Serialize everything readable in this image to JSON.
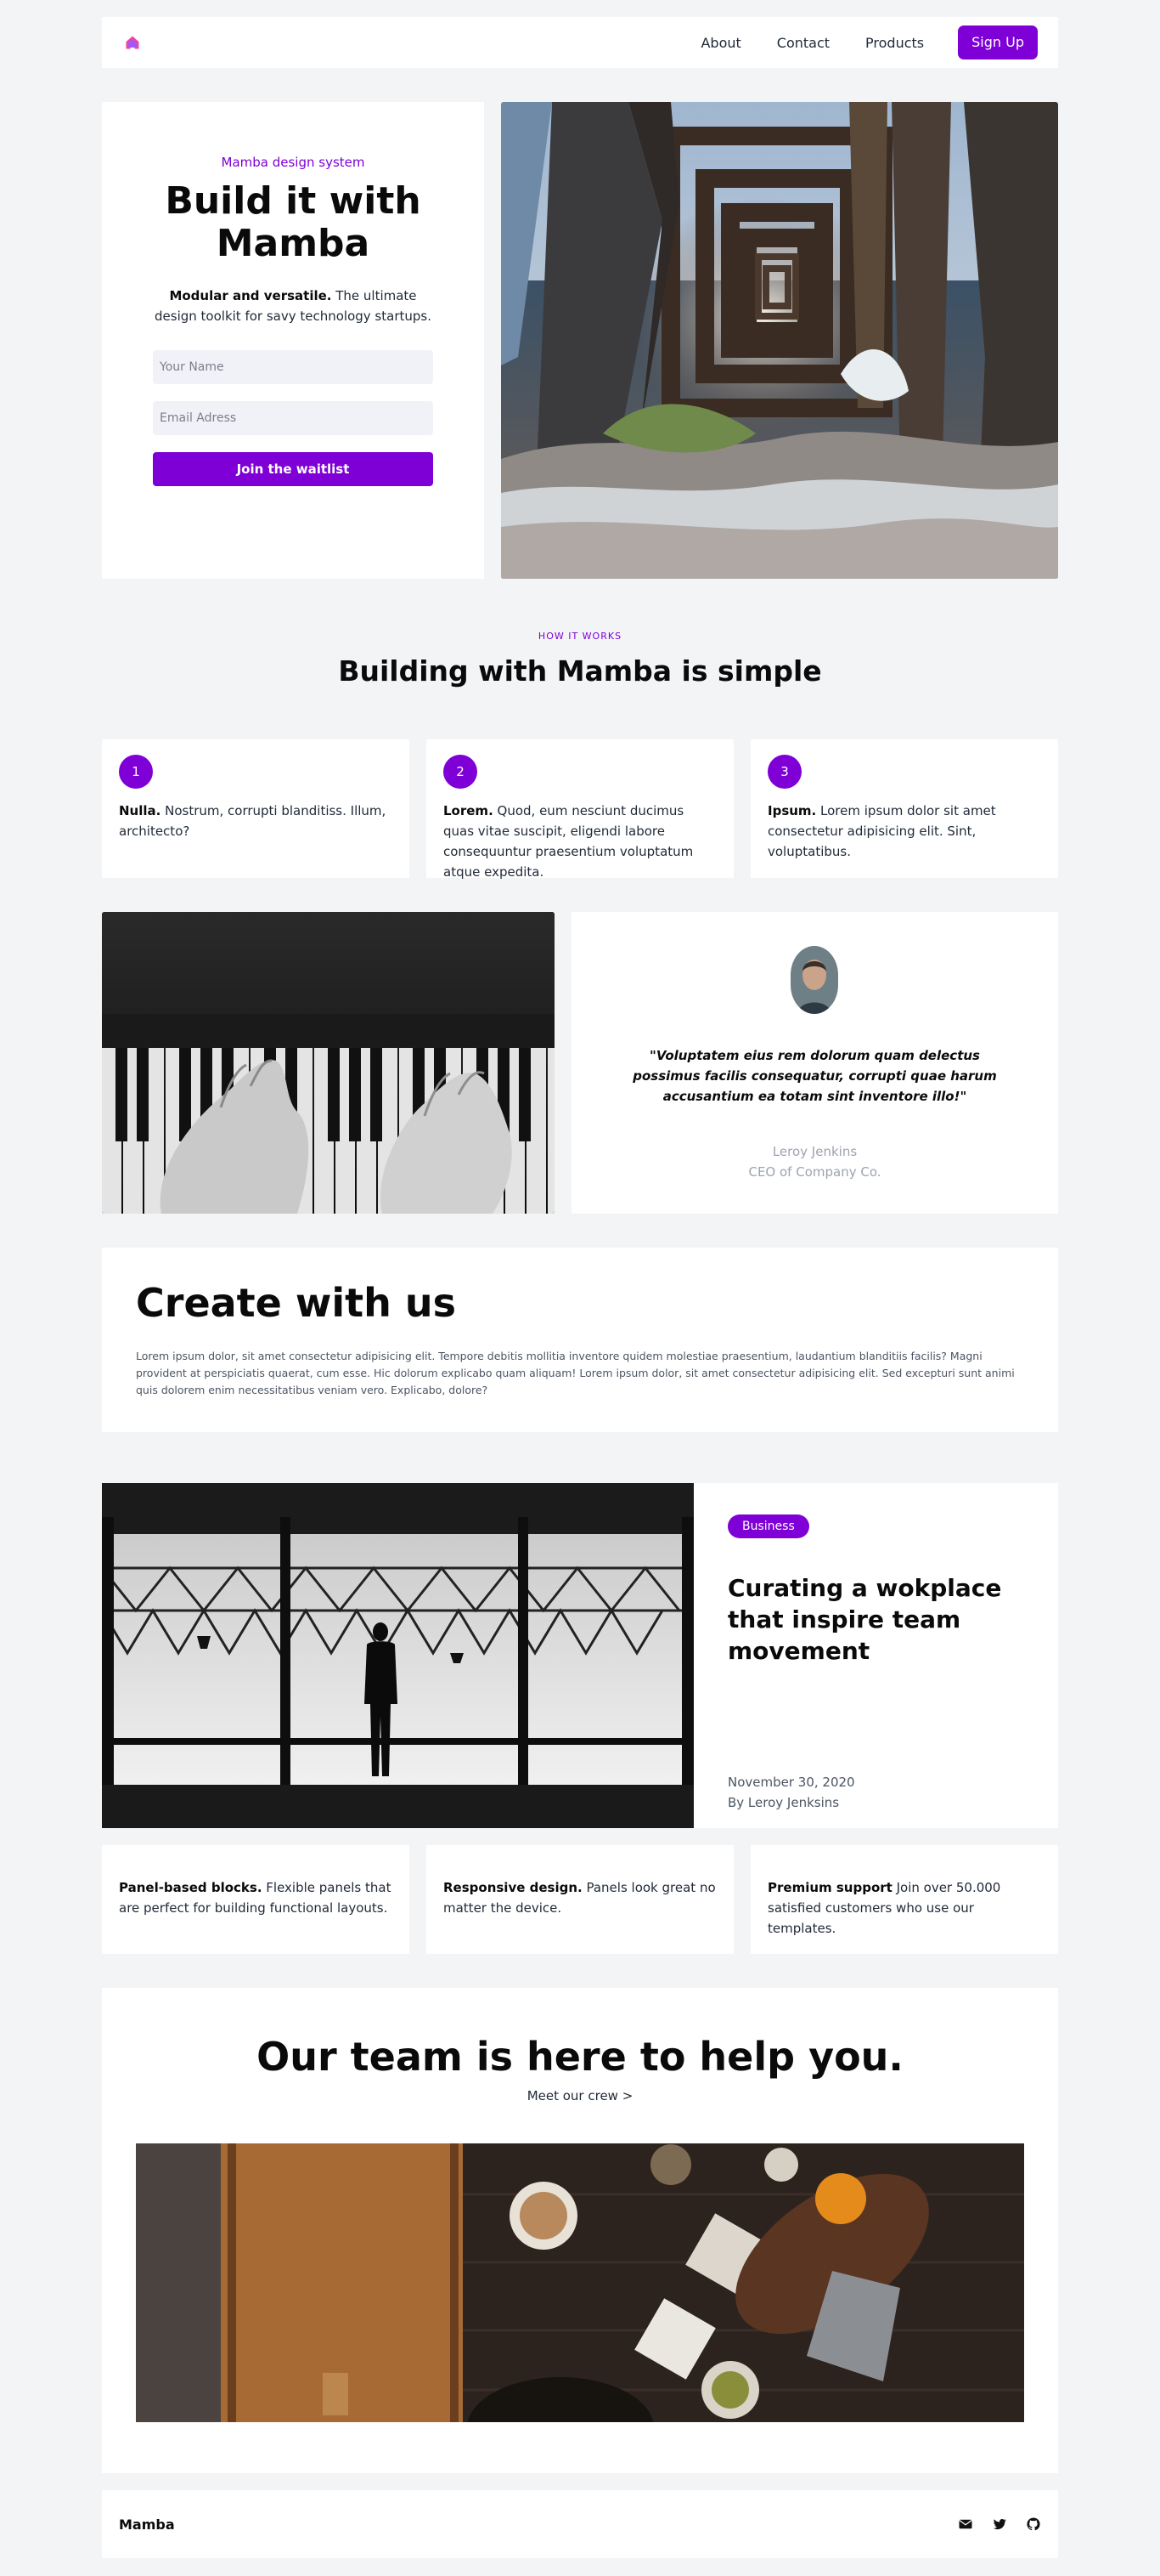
{
  "nav": {
    "links": [
      "About",
      "Contact",
      "Products"
    ],
    "cta": "Sign Up",
    "logo_icon": "home-icon"
  },
  "hero": {
    "eyebrow": "Mamba design system",
    "title": "Build it with Mamba",
    "subtitle_bold": "Modular and versatile.",
    "subtitle_rest": " The ultimate design toolkit for savy technology startups.",
    "name_placeholder": "Your Name",
    "email_placeholder": "Email Adress",
    "button": "Join the waitlist",
    "image": "pier-underside-photo"
  },
  "how": {
    "eyebrow": "HOW IT WORKS",
    "title": "Building with Mamba is simple",
    "steps": [
      {
        "num": "1",
        "bold": "Nulla.",
        "text": " Nostrum, corrupti blanditiss. Illum, architecto?"
      },
      {
        "num": "2",
        "bold": "Lorem.",
        "text": " Quod, eum nesciunt ducimus quas vitae suscipit, eligendi labore consequuntur praesentium voluptatum atque expedita."
      },
      {
        "num": "3",
        "bold": "Ipsum.",
        "text": " Lorem ipsum dolor sit amet consectetur adipisicing elit. Sint, voluptatibus."
      }
    ]
  },
  "testimonial": {
    "quote": "\"Voluptatem eius rem dolorum quam delectus possimus facilis consequatur, corrupti quae harum accusantium ea totam sint inventore illo!\"",
    "name": "Leroy Jenkins",
    "role": "CEO of Company Co.",
    "image": "piano-hands-photo",
    "avatar": "portrait-photo"
  },
  "create": {
    "title": "Create with us",
    "body": "Lorem ipsum dolor, sit amet consectetur adipisicing elit. Tempore debitis mollitia inventore quidem molestiae praesentium, laudantium blanditiis facilis? Magni provident at perspiciatis quaerat, cum esse. Hic dolorum explicabo quam aliquam! Lorem ipsum dolor, sit amet consectetur adipisicing elit. Sed excepturi sunt animi quis dolorem enim necessitatibus veniam vero. Explicabo, dolore?"
  },
  "article": {
    "badge": "Business",
    "title": "Curating a wokplace that inspire team movement",
    "date": "November 30, 2020",
    "author": "By Leroy Jenksins",
    "image": "hangar-silhouette-photo"
  },
  "features": [
    {
      "bold": "Panel-based blocks.",
      "text": " Flexible panels that are perfect for building functional layouts."
    },
    {
      "bold": "Responsive design.",
      "text": " Panels look great no matter the device."
    },
    {
      "bold": "Premium support",
      "text": " Join over 50.000 satisfied customers who use our templates."
    }
  ],
  "team": {
    "title": "Our team is here to help you.",
    "link": "Meet our crew >",
    "image": "kitchen-table-photo"
  },
  "footer": {
    "brand": "Mamba",
    "icons": [
      "mail-icon",
      "twitter-icon",
      "github-icon"
    ]
  },
  "colors": {
    "accent": "#7e00d6",
    "background": "#f3f4f6",
    "panel": "#ffffff"
  }
}
